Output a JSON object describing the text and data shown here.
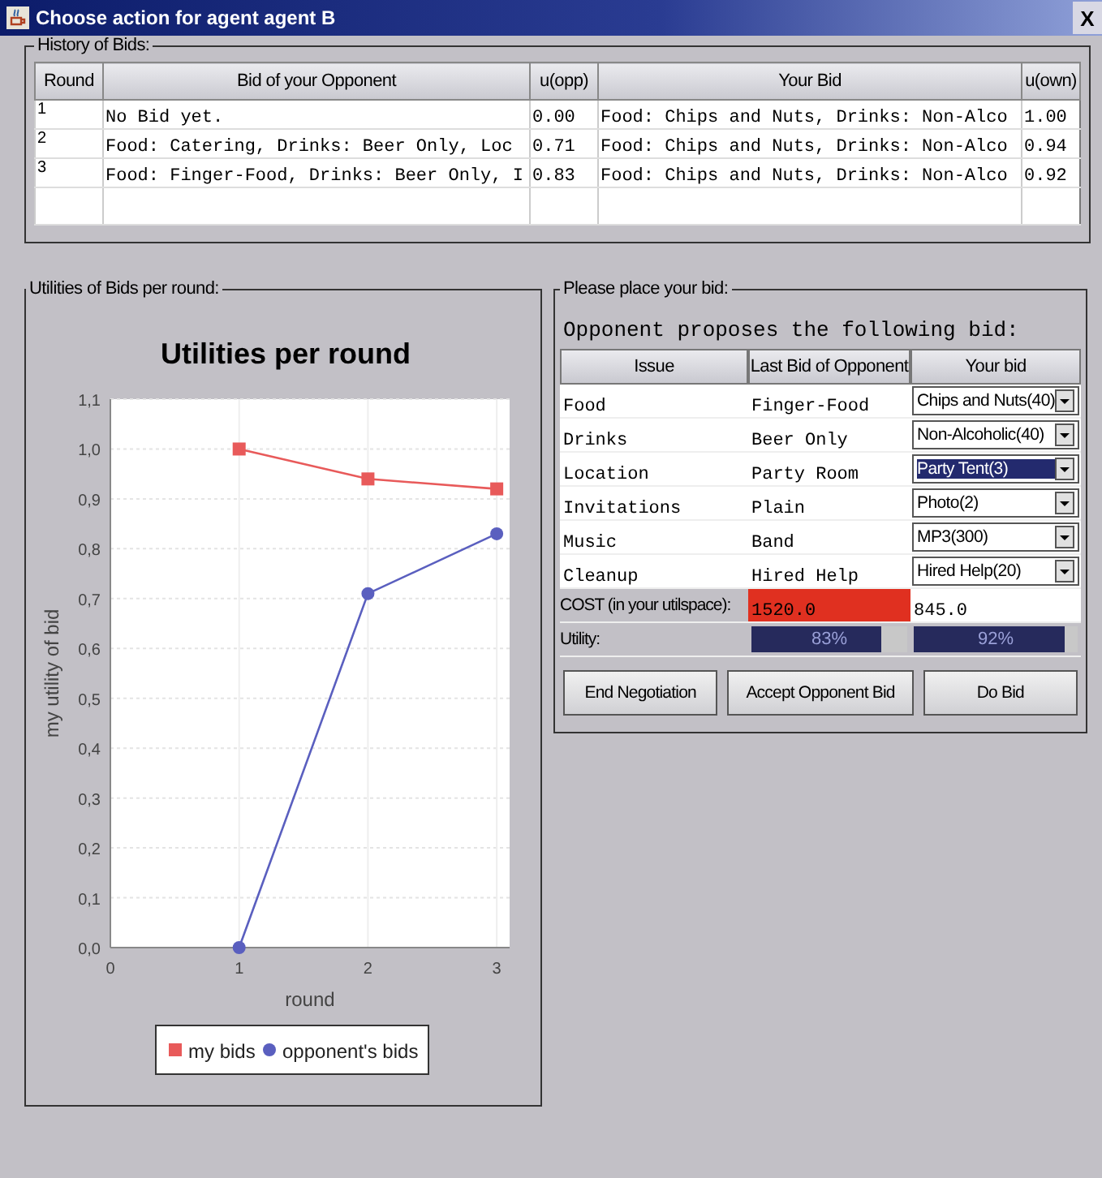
{
  "window": {
    "title": "Choose action for agent agent B",
    "close": "X"
  },
  "history": {
    "title": "History of Bids:",
    "columns": [
      "Round",
      "Bid of your Opponent",
      "u(opp)",
      "Your Bid",
      "u(own)"
    ],
    "rows": [
      [
        "1",
        "No Bid yet.",
        "0.00",
        "Food: Chips and Nuts, Drinks: Non-Alco",
        "1.00"
      ],
      [
        "2",
        "Food: Catering, Drinks: Beer Only, Loc",
        "0.71",
        "Food: Chips and Nuts, Drinks: Non-Alco",
        "0.94"
      ],
      [
        "3",
        "Food: Finger-Food, Drinks: Beer Only, I",
        "0.83",
        "Food: Chips and Nuts, Drinks: Non-Alco",
        "0.92"
      ]
    ]
  },
  "utilities_panel": {
    "title": "Utilities of Bids per round:",
    "chart_data": {
      "type": "line",
      "title": "Utilities per round",
      "xlabel": "round",
      "ylabel": "my utility of bid",
      "x": [
        1,
        2,
        3
      ],
      "series": [
        {
          "name": "my bids",
          "color": "#e85a5a",
          "marker": "square",
          "values": [
            1.0,
            0.94,
            0.92
          ]
        },
        {
          "name": "opponent's bids",
          "color": "#5a5fbf",
          "marker": "circle",
          "values": [
            0.0,
            0.71,
            0.83
          ]
        }
      ],
      "grid": true,
      "legend": true,
      "xlim": [
        0,
        3.1
      ],
      "ylim": [
        0,
        1.1
      ],
      "xticks": [
        {
          "value": 0,
          "label": "0"
        },
        {
          "value": 1,
          "label": "1"
        },
        {
          "value": 2,
          "label": "2"
        },
        {
          "value": 3,
          "label": "3"
        }
      ],
      "yticks": [
        {
          "value": 0,
          "label": "0,0"
        },
        {
          "value": 0.1,
          "label": "0,1"
        },
        {
          "value": 0.2,
          "label": "0,2"
        },
        {
          "value": 0.3,
          "label": "0,3"
        },
        {
          "value": 0.4,
          "label": "0,4"
        },
        {
          "value": 0.5,
          "label": "0,5"
        },
        {
          "value": 0.6,
          "label": "0,6"
        },
        {
          "value": 0.7,
          "label": "0,7"
        },
        {
          "value": 0.8,
          "label": "0,8"
        },
        {
          "value": 0.9,
          "label": "0,9"
        },
        {
          "value": 1.0,
          "label": "1,0"
        },
        {
          "value": 1.1,
          "label": "1,1"
        }
      ]
    }
  },
  "bid_panel": {
    "title": "Please place your bid:",
    "heading": "Opponent proposes the following bid:",
    "columns": [
      "Issue",
      "Last Bid of Opponent",
      "Your bid"
    ],
    "rows": [
      {
        "issue": "Food",
        "opponent_bid": "Finger-Food",
        "your_bid": "Chips and Nuts(40)",
        "selected": false
      },
      {
        "issue": "Drinks",
        "opponent_bid": "Beer Only",
        "your_bid": "Non-Alcoholic(40)",
        "selected": false
      },
      {
        "issue": "Location",
        "opponent_bid": "Party Room",
        "your_bid": "Party Tent(3)",
        "selected": true
      },
      {
        "issue": "Invitations",
        "opponent_bid": "Plain",
        "your_bid": "Photo(2)",
        "selected": false
      },
      {
        "issue": "Music",
        "opponent_bid": "Band",
        "your_bid": "MP3(300)",
        "selected": false
      },
      {
        "issue": "Cleanup",
        "opponent_bid": "Hired Help",
        "your_bid": "Hired Help(20)",
        "selected": false
      }
    ],
    "cost": {
      "label": "COST (in your utilspace):",
      "opponent": {
        "value": "1520.0",
        "warning": true
      },
      "yours": {
        "value": "845.0",
        "warning": false
      }
    },
    "utility": {
      "label": "Utility:",
      "opponent": {
        "reading": "83%",
        "level": 0.83
      },
      "yours": {
        "reading": "92%",
        "level": 0.92
      }
    },
    "buttons": [
      "End Negotiation",
      "Accept Opponent Bid",
      "Do Bid"
    ]
  }
}
